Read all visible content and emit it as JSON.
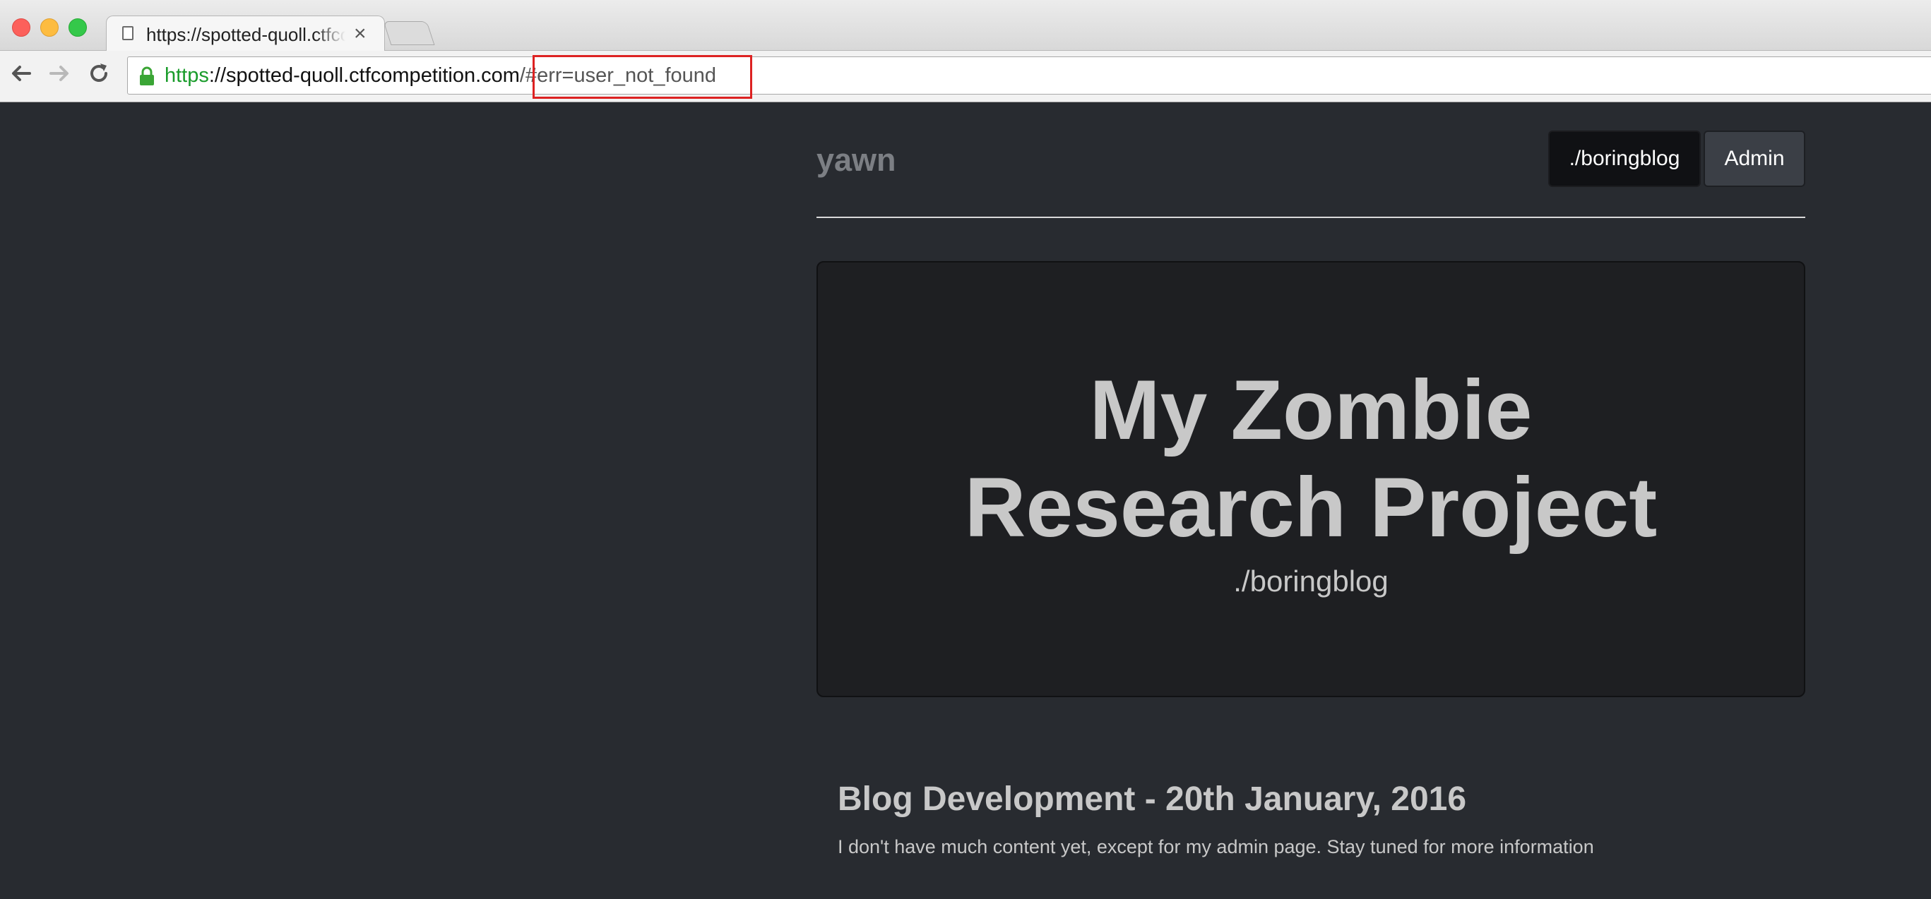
{
  "browser": {
    "tab_title": "https://spotted-quoll.ctfcompetition.com/",
    "tab_close": "×",
    "url": {
      "scheme": "https",
      "separator": "://",
      "host": "spotted-quoll.ctfcompetition.com",
      "hash": "/#err=user_not_found"
    },
    "colors": {
      "scheme_green": "#1a9c2b",
      "highlight_red": "#dd2222"
    }
  },
  "site": {
    "brand": "yawn",
    "nav": [
      {
        "label": "./boringblog",
        "active": true
      },
      {
        "label": "Admin",
        "active": false
      }
    ]
  },
  "jumbotron": {
    "title_line1": "My Zombie",
    "title_line2": "Research Project",
    "subtitle": "./boringblog"
  },
  "post": {
    "title": "Blog Development - 20th January, 2016",
    "body": "I don't have much content yet, except for my admin page. Stay tuned for more information"
  },
  "theme": {
    "background": "#282b30",
    "text": "#c8c8c8"
  }
}
